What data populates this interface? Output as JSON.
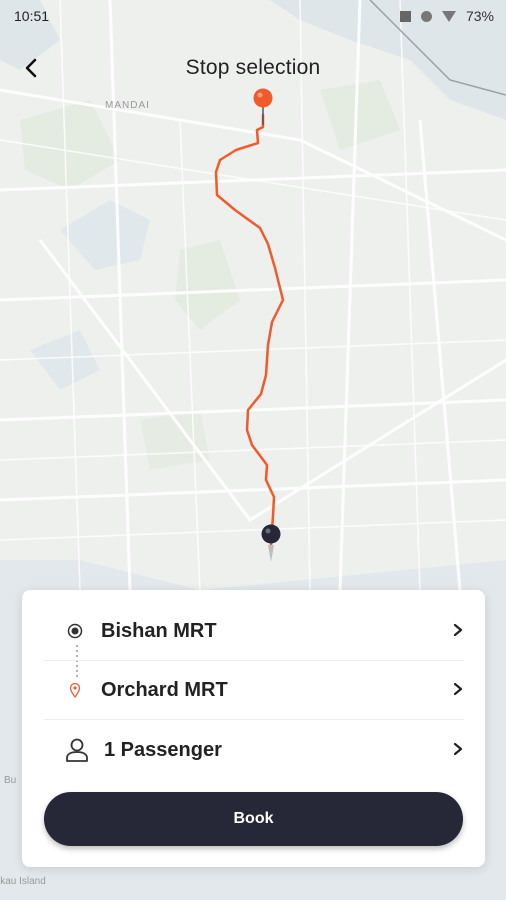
{
  "status_bar": {
    "time": "10:51",
    "battery": "73%"
  },
  "header": {
    "title": "Stop selection"
  },
  "map": {
    "labels": {
      "north_area": "MANDAI",
      "left_edge": "Bu",
      "bottom_left": "ikau Island"
    },
    "route_color": "#f15a2b"
  },
  "trip": {
    "origin": "Bishan MRT",
    "destination": "Orchard MRT",
    "passengers": "1 Passenger"
  },
  "actions": {
    "book_label": "Book"
  },
  "icons": {
    "back": "chevron-left-icon",
    "origin": "origin-dot-icon",
    "destination": "destination-pin-icon",
    "passenger": "user-icon",
    "chevron": "chevron-right-icon"
  }
}
